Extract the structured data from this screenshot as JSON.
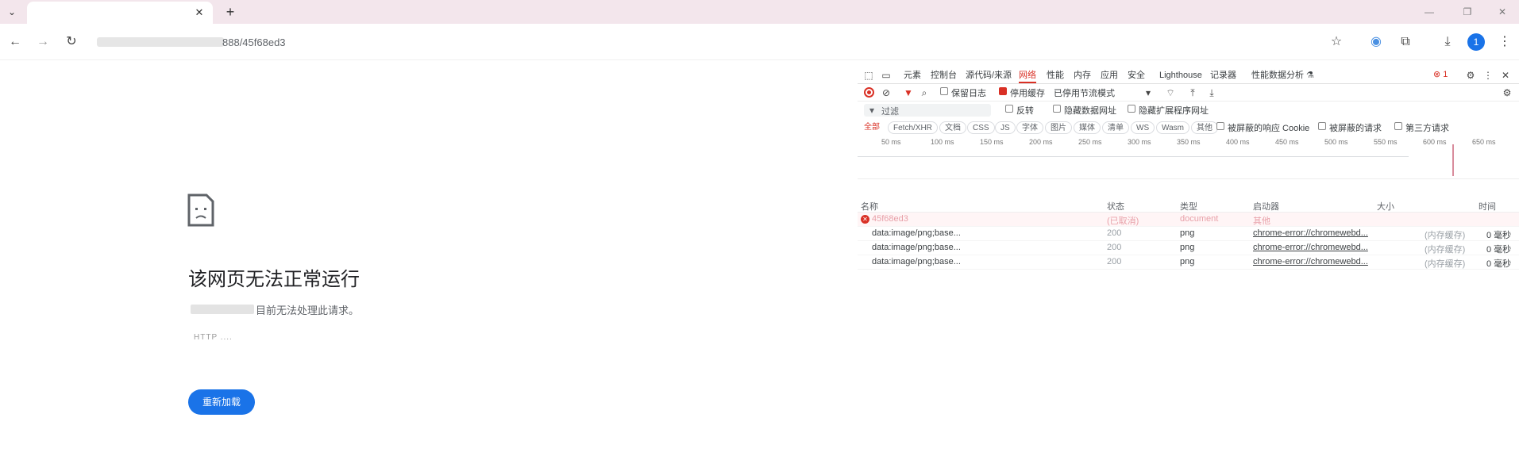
{
  "browser": {
    "tab": {
      "title": "",
      "close_label": "✕"
    },
    "new_tab_label": "+",
    "url": "888/45f68ed3",
    "profile_initial": "1",
    "window_controls": [
      "—",
      "❐",
      "✕"
    ]
  },
  "error_page": {
    "title": "该网页无法正常运行",
    "subtitle": "目前无法处理此请求。",
    "error_code": "HTTP ....",
    "reload_label": "重新加载"
  },
  "devtools": {
    "tabs": [
      "元素",
      "控制台",
      "源代码/来源",
      "网络",
      "性能",
      "内存",
      "应用",
      "安全",
      "Lighthouse",
      "记录器",
      "性能数据分析 ⚗"
    ],
    "active_tab": "网络",
    "error_count": "1",
    "toolbar": {
      "preserve_log": "保留日志",
      "disable_cache": "停用缓存",
      "throttling": "已停用节流模式"
    },
    "filter": {
      "placeholder": "过滤",
      "invert": "反转",
      "hide_data_urls": "隐藏数据网址",
      "hide_extension_urls": "隐藏扩展程序网址"
    },
    "type_filters": [
      "全部",
      "Fetch/XHR",
      "文档",
      "CSS",
      "JS",
      "字体",
      "图片",
      "媒体",
      "清单",
      "WS",
      "Wasm",
      "其他"
    ],
    "extra_filters": {
      "blocked_cookies": "被屏蔽的响应 Cookie",
      "blocked_requests": "被屏蔽的请求",
      "third_party": "第三方请求"
    },
    "timeline_ticks": [
      "50 ms",
      "100 ms",
      "150 ms",
      "200 ms",
      "250 ms",
      "300 ms",
      "350 ms",
      "400 ms",
      "450 ms",
      "500 ms",
      "550 ms",
      "600 ms",
      "650 ms"
    ],
    "columns": {
      "name": "名称",
      "status": "状态",
      "type": "类型",
      "initiator": "启动器",
      "size": "大小",
      "time": "时间"
    },
    "rows": [
      {
        "name": "45f68ed3",
        "status": "(已取消)",
        "type": "document",
        "initiator": "其他",
        "size": "",
        "time": "",
        "error": true
      },
      {
        "name": "data:image/png;base...",
        "status": "200",
        "type": "png",
        "initiator": "chrome-error://chromewebd...",
        "size": "(内存缓存)",
        "time": "0 毫秒",
        "error": false
      },
      {
        "name": "data:image/png;base...",
        "status": "200",
        "type": "png",
        "initiator": "chrome-error://chromewebd...",
        "size": "(内存缓存)",
        "time": "0 毫秒",
        "error": false
      },
      {
        "name": "data:image/png;base...",
        "status": "200",
        "type": "png",
        "initiator": "chrome-error://chromewebd...",
        "size": "(内存缓存)",
        "time": "0 毫秒",
        "error": false
      }
    ]
  },
  "colors": {
    "accent": "#1a73e8",
    "devtools_active": "#d93025",
    "tabstrip": "#f3e6ec"
  }
}
